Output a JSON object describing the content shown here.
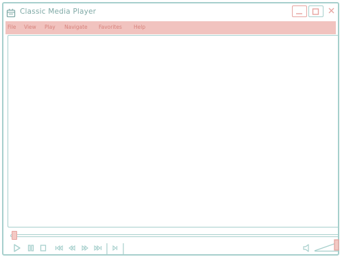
{
  "window": {
    "title": "Classic Media Player"
  },
  "menu": {
    "items": [
      "File",
      "View",
      "Play",
      "Navigate",
      "Favorites",
      "Help"
    ]
  },
  "controls": {
    "buttons": [
      "play-icon",
      "pause-icon",
      "stop-icon",
      "previous-frame-icon",
      "rewind-icon",
      "fast-forward-icon",
      "next-frame-icon",
      "step-icon"
    ]
  },
  "seek": {
    "position": 0
  },
  "volume": {
    "level": 1.0
  },
  "colors": {
    "teal": "#a6cfcc",
    "pink": "#e6a4a0",
    "menu_bg": "#f1c3bf",
    "menu_text": "#d7827c"
  }
}
